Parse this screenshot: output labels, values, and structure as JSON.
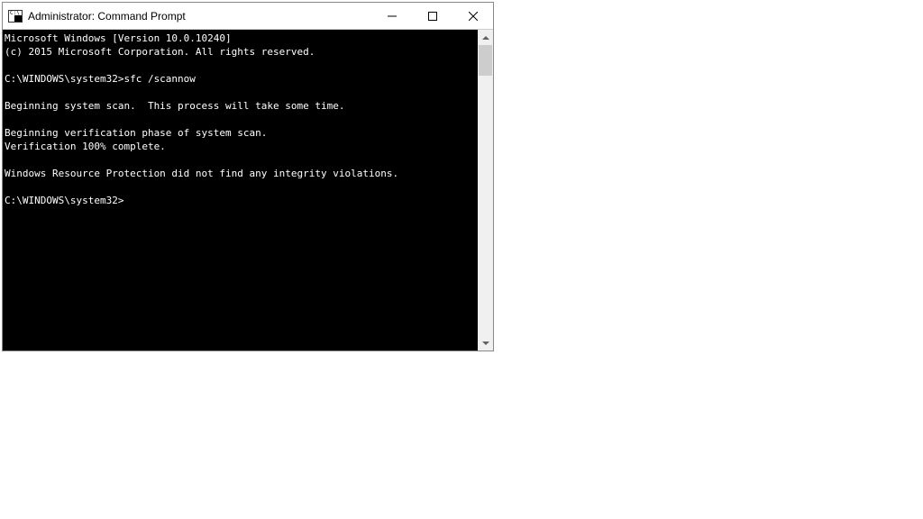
{
  "window": {
    "title": "Administrator: Command Prompt"
  },
  "terminal": {
    "lines": [
      "Microsoft Windows [Version 10.0.10240]",
      "(c) 2015 Microsoft Corporation. All rights reserved.",
      "",
      "C:\\WINDOWS\\system32>sfc /scannow",
      "",
      "Beginning system scan.  This process will take some time.",
      "",
      "Beginning verification phase of system scan.",
      "Verification 100% complete.",
      "",
      "Windows Resource Protection did not find any integrity violations.",
      "",
      "C:\\WINDOWS\\system32>"
    ]
  },
  "icons": {
    "minimize": "minimize-icon",
    "maximize": "maximize-icon",
    "close": "close-icon",
    "scroll_up": "chevron-up-icon",
    "scroll_down": "chevron-down-icon"
  },
  "colors": {
    "terminal_bg": "#000000",
    "terminal_fg": "#ffffff",
    "window_border": "#888888",
    "scrollbar_bg": "#f0f0f0",
    "scrollbar_thumb": "#cdcdcd"
  }
}
